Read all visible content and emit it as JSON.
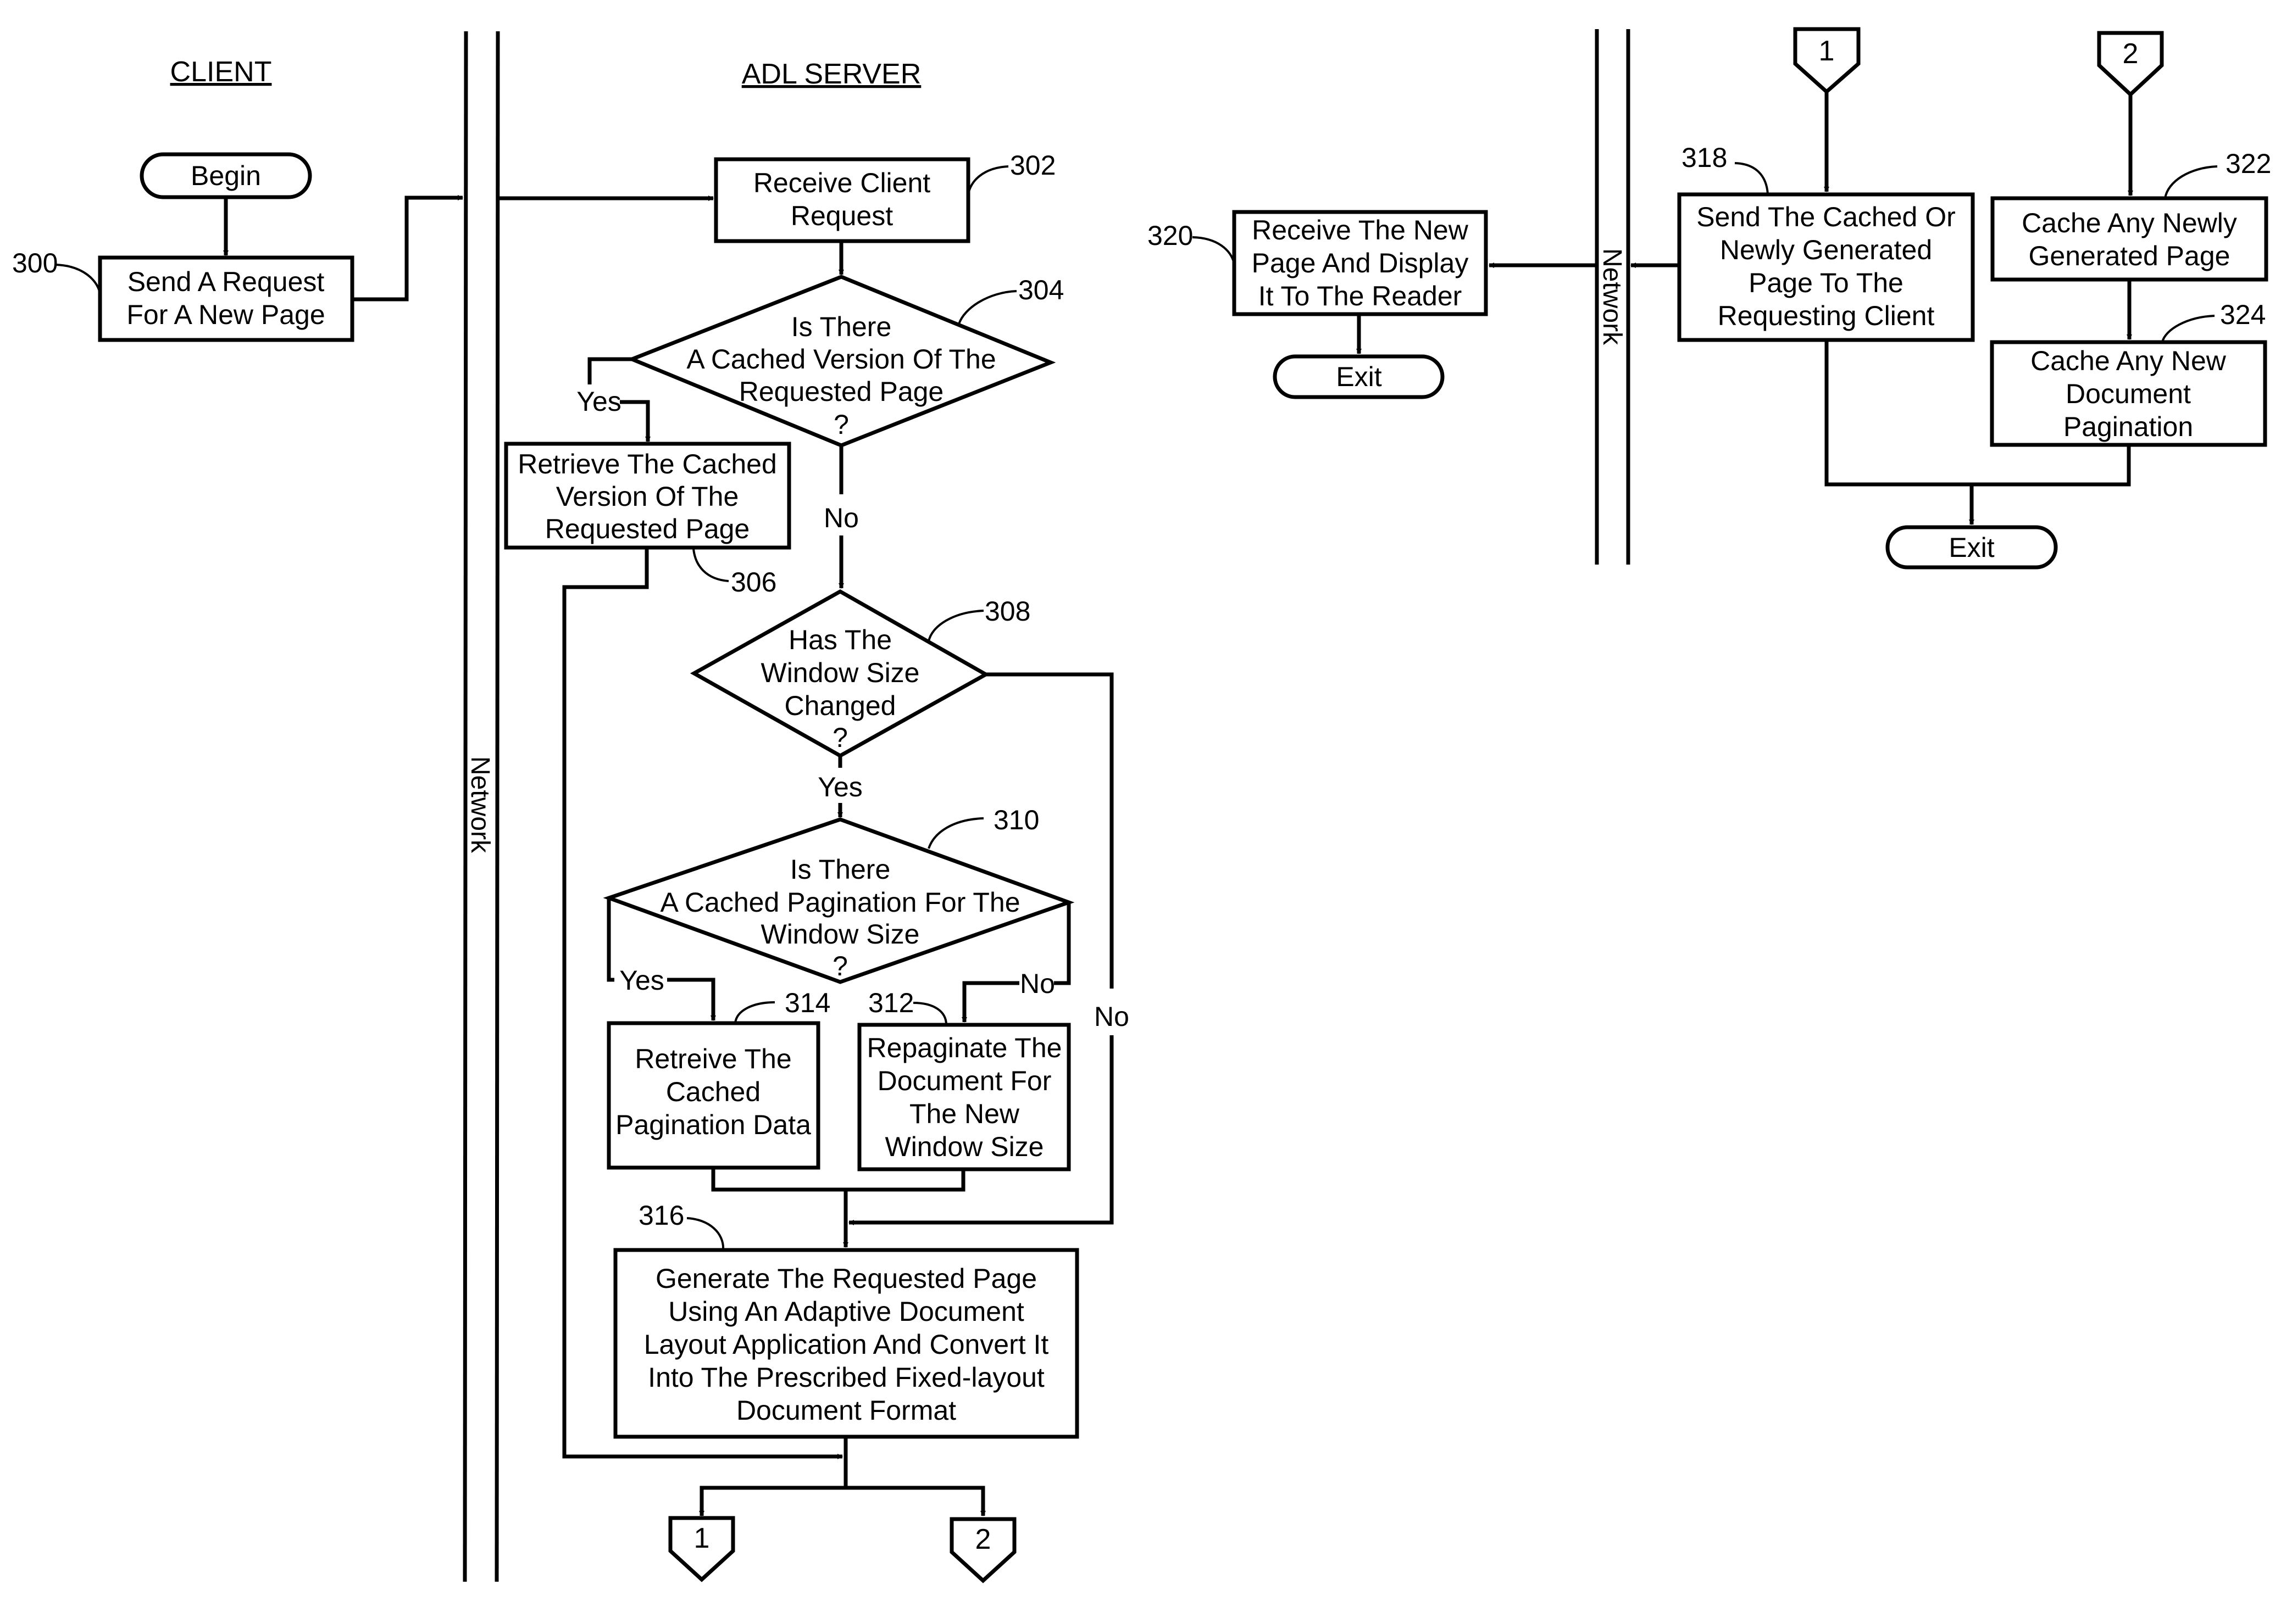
{
  "lanes": {
    "client": "CLIENT",
    "server": "ADL SERVER",
    "network_left": "Network",
    "network_right": "Network"
  },
  "nodes": {
    "begin": {
      "label": "Begin"
    },
    "n300": {
      "ref": "300",
      "lines": [
        "Send A Request",
        "For A New Page"
      ]
    },
    "n302": {
      "ref": "302",
      "lines": [
        "Receive Client",
        "Request"
      ]
    },
    "n304": {
      "ref": "304",
      "lines": [
        "Is There",
        "A Cached Version Of The",
        "Requested Page",
        "?"
      ]
    },
    "n306": {
      "ref": "306",
      "lines": [
        "Retrieve The Cached",
        "Version Of The",
        "Requested Page"
      ]
    },
    "n308": {
      "ref": "308",
      "lines": [
        "Has The",
        "Window Size",
        "Changed",
        "?"
      ]
    },
    "n310": {
      "ref": "310",
      "lines": [
        "Is There",
        "A Cached Pagination For The",
        "Window Size",
        "?"
      ]
    },
    "n312": {
      "ref": "312",
      "lines": [
        "Repaginate The",
        "Document For",
        "The New",
        "Window Size"
      ]
    },
    "n314": {
      "ref": "314",
      "lines": [
        "Retreive The",
        "Cached",
        "Pagination Data"
      ]
    },
    "n316": {
      "ref": "316",
      "lines": [
        "Generate The Requested Page",
        "Using An Adaptive Document",
        "Layout Application And Convert It",
        "Into The Prescribed Fixed-layout",
        "Document Format"
      ]
    },
    "n318": {
      "ref": "318",
      "lines": [
        "Send The Cached Or",
        "Newly Generated",
        "Page To The",
        "Requesting Client"
      ]
    },
    "n320": {
      "ref": "320",
      "lines": [
        "Receive The New",
        "Page And Display",
        "It To The Reader"
      ]
    },
    "n322": {
      "ref": "322",
      "lines": [
        "Cache Any Newly",
        "Generated Page"
      ]
    },
    "n324": {
      "ref": "324",
      "lines": [
        "Cache Any New",
        "Document",
        "Pagination"
      ]
    },
    "exit_client": {
      "label": "Exit"
    },
    "exit_server": {
      "label": "Exit"
    }
  },
  "connectors": {
    "c1": "1",
    "c2": "2"
  },
  "edge_labels": {
    "yes_304": "Yes",
    "no_304": "No",
    "yes_308": "Yes",
    "no_308": "No",
    "yes_310": "Yes",
    "no_310": "No"
  }
}
